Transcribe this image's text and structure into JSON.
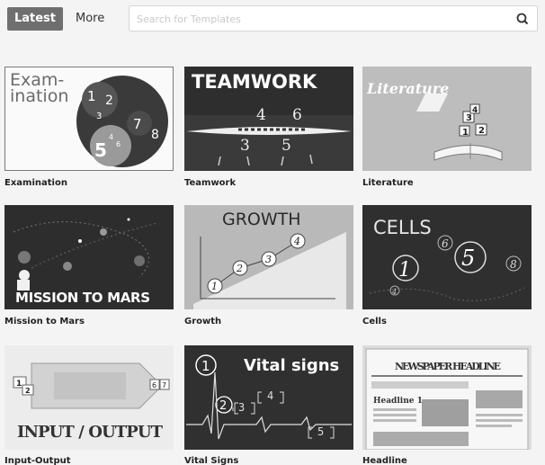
{
  "tabs": {
    "latest": "Latest",
    "more": "More"
  },
  "search": {
    "placeholder": "Search for Templates"
  },
  "templates": [
    {
      "name": "Examination",
      "art_text": [
        "Exam-",
        "ination"
      ],
      "numbers": [
        "1",
        "2",
        "3",
        "4",
        "5",
        "6",
        "7",
        "8"
      ]
    },
    {
      "name": "Teamwork",
      "art_text": "TEAMWORK",
      "numbers": [
        "4",
        "6",
        "3",
        "5"
      ]
    },
    {
      "name": "Literature",
      "art_text": "Literature",
      "numbers": [
        "1",
        "2",
        "3",
        "4"
      ]
    },
    {
      "name": "Mission to Mars",
      "art_text": "MISSION TO MARS"
    },
    {
      "name": "Growth",
      "art_text": "GROWTH",
      "numbers": [
        "1",
        "2",
        "3",
        "4"
      ]
    },
    {
      "name": "Cells",
      "art_text": "CELLS",
      "numbers": [
        "1",
        "5",
        "6",
        "8",
        "4"
      ]
    },
    {
      "name": "Input-Output",
      "art_text": "INPUT / OUTPUT",
      "numbers": [
        "1",
        "2",
        "6",
        "7"
      ]
    },
    {
      "name": "Vital Signs",
      "art_text": "Vital signs",
      "numbers": [
        "1",
        "2",
        "3",
        "4",
        "5"
      ]
    },
    {
      "name": "Headline",
      "art_text": "NEWSPAPER HEADLINE",
      "sub_text": "Headline 1"
    }
  ]
}
